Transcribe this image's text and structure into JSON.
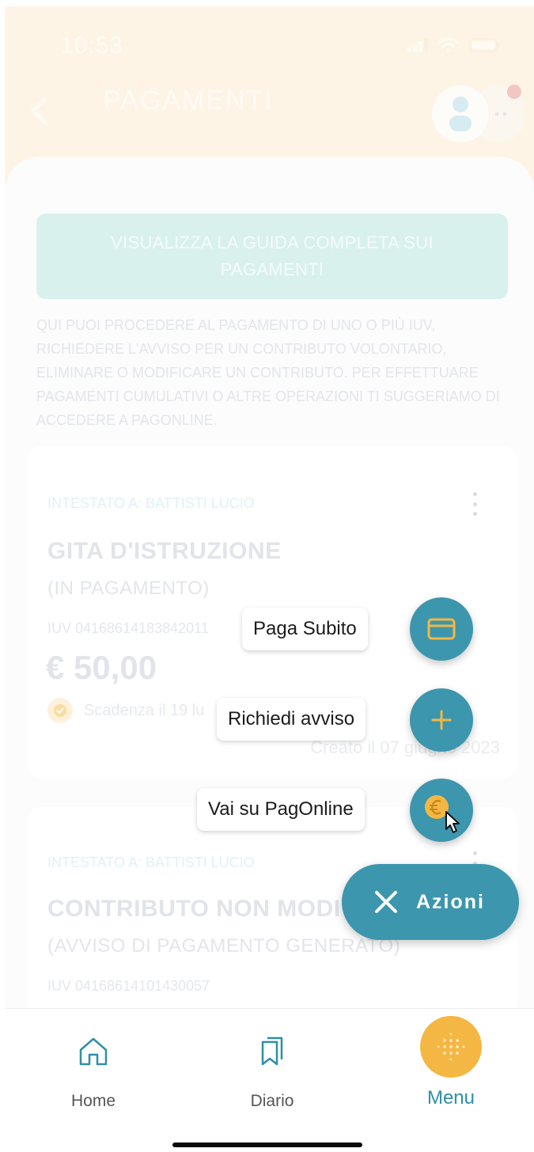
{
  "status_bar": {
    "time": "10:53"
  },
  "header": {
    "title": "PAGAMENTI"
  },
  "guide_button": {
    "label": "VISUALIZZA LA GUIDA COMPLETA SUI PAGAMENTI"
  },
  "intro_text": "QUI PUOI PROCEDERE AL PAGAMENTO DI UNO O PIÙ IUV, RICHIEDERE L'AVVISO PER UN CONTRIBUTO VOLONTARIO, ELIMINARE O MODIFICARE UN CONTRIBUTO. PER EFFETTUARE PAGAMENTI CUMULATIVI O ALTRE OPERAZIONI TI SUGGERIAMO DI ACCEDERE A PAGONLINE.",
  "cards": [
    {
      "owner": "INTESTATO A: BATTISTI LUCIO",
      "title": "GITA D'ISTRUZIONE",
      "status": "(IN PAGAMENTO)",
      "iuv": "IUV 04168614183842011",
      "amount": "€ 50,00",
      "due": "Scadenza il 19 lu",
      "created": "Creato il 07 giugno 2023"
    },
    {
      "owner": "INTESTATO A: BATTISTI LUCIO",
      "title": "CONTRIBUTO NON MODI",
      "status": "(AVVISO DI PAGAMENTO GENERATO)",
      "iuv": "IUV 04168614101430057"
    }
  ],
  "actions": {
    "pay_now": "Paga Subito",
    "request_notice": "Richiedi avviso",
    "pagonline": "Vai su PagOnline",
    "toggle": "Azioni"
  },
  "tabbar": {
    "home": "Home",
    "diary": "Diario",
    "menu": "Menu"
  },
  "colors": {
    "header_bg": "#fdf4e6",
    "accent_teal": "#3c96ad",
    "accent_orange": "#f4b743",
    "guide_bg": "#d8f1ed"
  }
}
